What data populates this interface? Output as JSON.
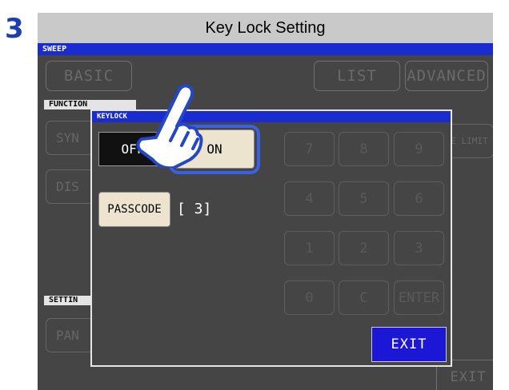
{
  "step_number": "3",
  "title": "Key Lock Setting",
  "screen": {
    "header": "SWEEP",
    "tabs": {
      "basic": "BASIC",
      "list": "LIST",
      "advanced": "ADVANCED"
    },
    "function_label": "FUNCTION",
    "bg_buttons": {
      "syn": "SYN",
      "dis": "DIS",
      "range_limit": "NGE LIMIT",
      "pan": "PAN"
    },
    "setting_label": "SETTIN",
    "exit_label": "EXIT"
  },
  "dialog": {
    "title": "KEYLOCK",
    "off_label": "OFF",
    "on_label": "ON",
    "passcode_label": "PASSCODE",
    "passcode_value": "[  3]",
    "keys": [
      "7",
      "8",
      "9",
      "4",
      "5",
      "6",
      "1",
      "2",
      "3",
      "0",
      "C",
      "ENTER"
    ],
    "exit_label": "EXIT"
  },
  "icons": {
    "pointer": "pointing-hand-icon"
  },
  "colors": {
    "blue_bar": "#1a2ccf",
    "highlight": "#3a60e6",
    "exit_button": "#1b17d4",
    "key_button": "#ece4cf"
  }
}
